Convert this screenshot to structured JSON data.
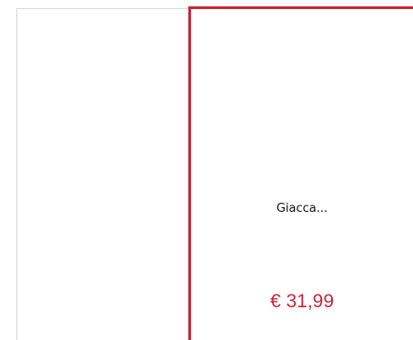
{
  "products": [
    {
      "name": "",
      "price": ""
    },
    {
      "name": "Giacca...",
      "price": "€ 31,99"
    }
  ],
  "colors": {
    "accent": "#c8283a",
    "card_border": "#d8d8d8",
    "text": "#111111",
    "background": "#ffffff"
  }
}
